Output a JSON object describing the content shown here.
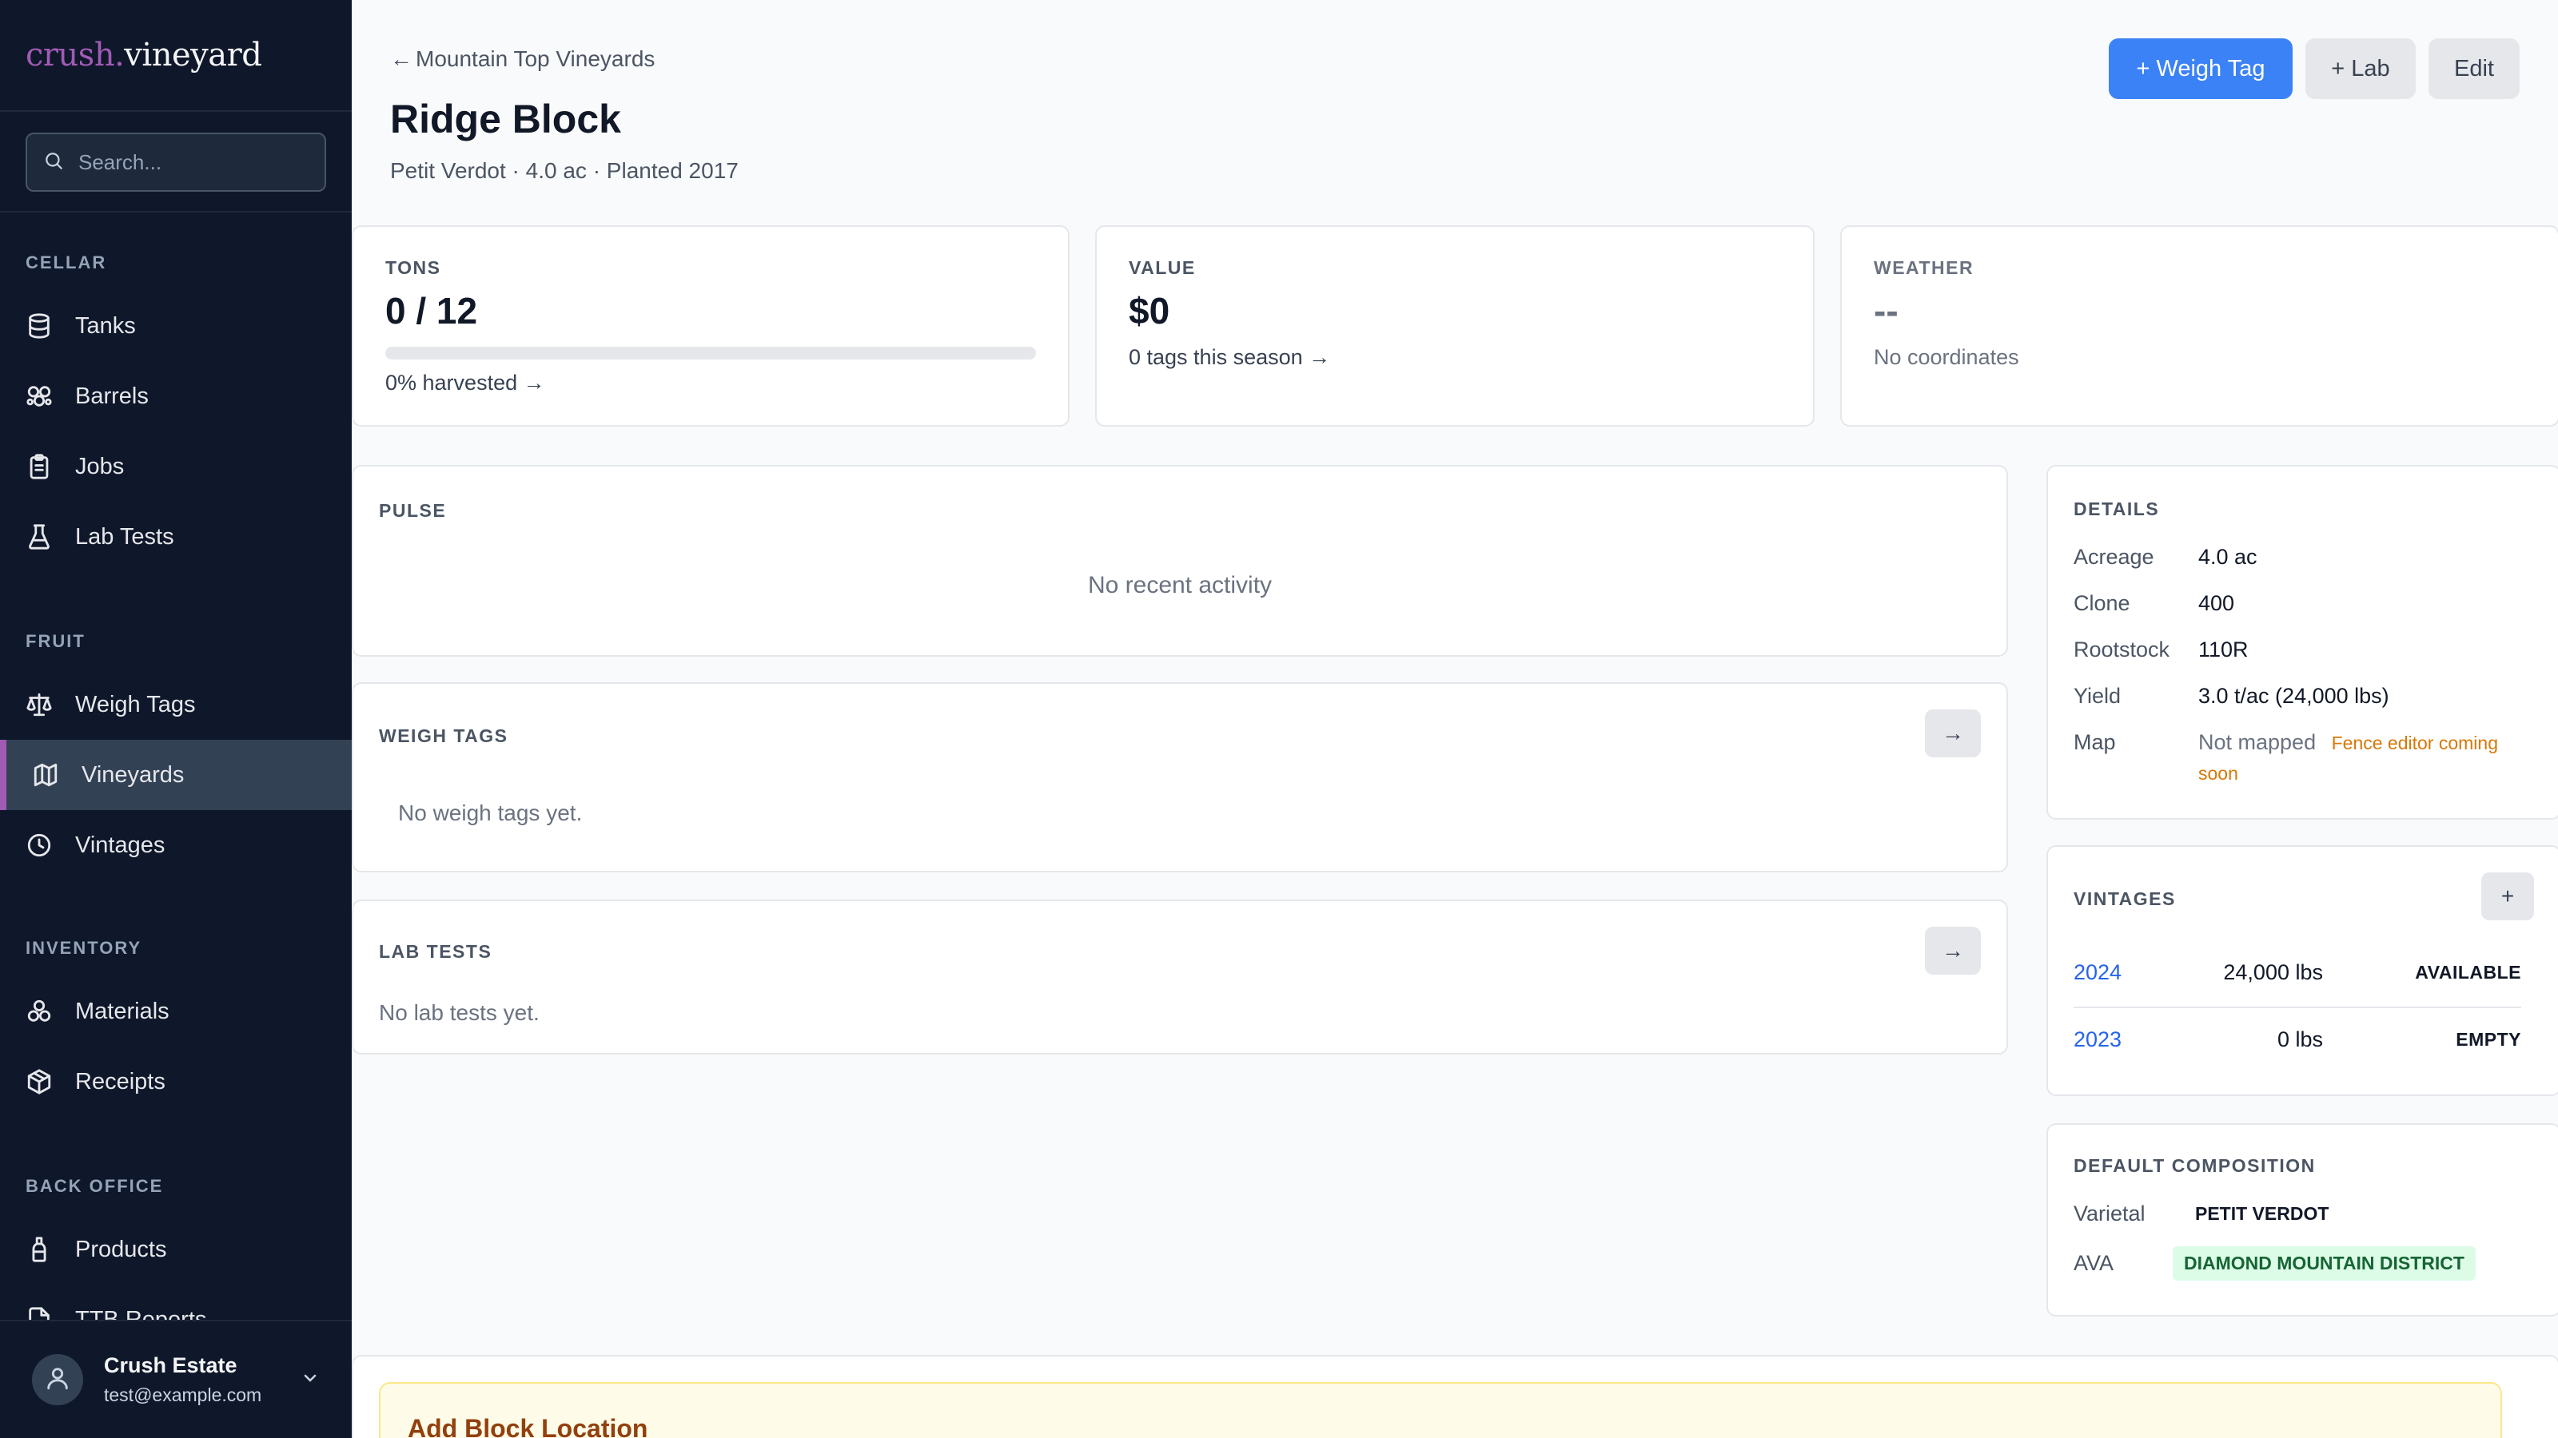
{
  "brand": {
    "part1": "crush.",
    "part2": "vineyard"
  },
  "search": {
    "placeholder": "Search..."
  },
  "sidebar": {
    "sections": [
      {
        "title": "CELLAR",
        "items": [
          {
            "label": "Tanks",
            "icon": "database-icon"
          },
          {
            "label": "Barrels",
            "icon": "barrels-icon"
          },
          {
            "label": "Jobs",
            "icon": "clipboard-icon"
          },
          {
            "label": "Lab Tests",
            "icon": "flask-icon"
          }
        ]
      },
      {
        "title": "FRUIT",
        "items": [
          {
            "label": "Weigh Tags",
            "icon": "scale-icon"
          },
          {
            "label": "Vineyards",
            "icon": "map-icon",
            "active": true
          },
          {
            "label": "Vintages",
            "icon": "clock-icon"
          }
        ]
      },
      {
        "title": "INVENTORY",
        "items": [
          {
            "label": "Materials",
            "icon": "materials-icon"
          },
          {
            "label": "Receipts",
            "icon": "package-icon"
          }
        ]
      },
      {
        "title": "BACK OFFICE",
        "items": [
          {
            "label": "Products",
            "icon": "bottle-icon"
          },
          {
            "label": "TTB Reports",
            "icon": "file-icon"
          }
        ]
      }
    ],
    "user": {
      "name": "Crush Estate",
      "email": "test@example.com"
    }
  },
  "header": {
    "breadcrumb_arrow": "←",
    "breadcrumb": "Mountain Top Vineyards",
    "title": "Ridge Block",
    "subtitle": "Petit Verdot · 4.0 ac · Planted 2017",
    "buttons": {
      "weigh_tag": "+ Weigh Tag",
      "lab": "+ Lab",
      "edit": "Edit"
    }
  },
  "stats": {
    "tons": {
      "label": "TONS",
      "value": "0 / 12",
      "progress_fraction": 0.0,
      "sub": "0% harvested →"
    },
    "value": {
      "label": "VALUE",
      "value": "$0",
      "sub": "0 tags this season →"
    },
    "weather": {
      "label": "WEATHER",
      "value": "--",
      "sub": "No coordinates"
    }
  },
  "pulse": {
    "label": "PULSE",
    "empty": "No recent activity"
  },
  "weigh_tags": {
    "label": "WEIGH TAGS",
    "arrow": "→",
    "empty": "No weigh tags yet."
  },
  "lab_tests": {
    "label": "LAB TESTS",
    "arrow": "→",
    "empty": "No lab tests yet."
  },
  "details": {
    "label": "DETAILS",
    "rows": [
      {
        "key": "Acreage",
        "value": "4.0 ac"
      },
      {
        "key": "Clone",
        "value": "400"
      },
      {
        "key": "Rootstock",
        "value": "110R"
      },
      {
        "key": "Yield",
        "value": "3.0 t/ac (24,000 lbs)"
      }
    ],
    "map": {
      "key": "Map",
      "value": "Not mapped",
      "note_line1": "Fence editor coming",
      "note_line2": "soon"
    }
  },
  "vintages": {
    "label": "VINTAGES",
    "add": "+",
    "rows": [
      {
        "year": "2024",
        "lbs": "24,000 lbs",
        "status": "AVAILABLE"
      },
      {
        "year": "2023",
        "lbs": "0 lbs",
        "status": "EMPTY"
      }
    ]
  },
  "composition": {
    "label": "DEFAULT COMPOSITION",
    "varietal": {
      "key": "Varietal",
      "value": "PETIT VERDOT"
    },
    "ava": {
      "key": "AVA",
      "value": "DIAMOND MOUNTAIN DISTRICT"
    }
  },
  "banner": {
    "title": "Add Block Location"
  },
  "colors": {
    "accent": "#a05bb5",
    "primary": "#3b82f6",
    "sidebar_bg": "#0f172a",
    "link": "#2563eb",
    "warning": "#d97706"
  }
}
